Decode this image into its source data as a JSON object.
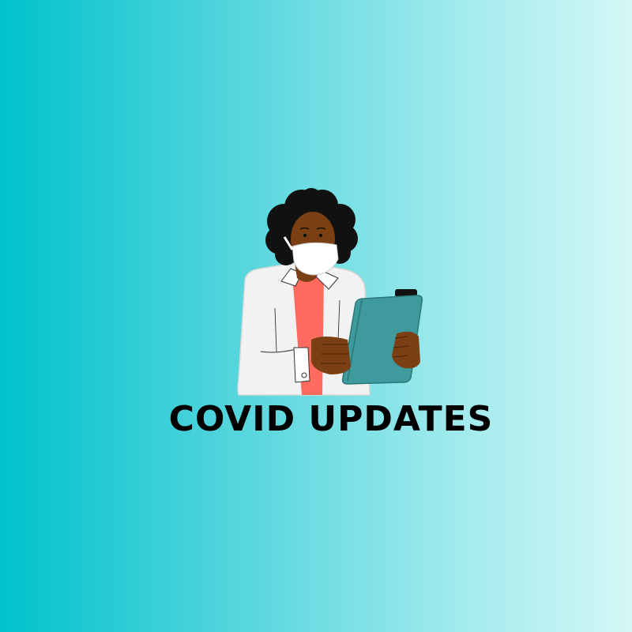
{
  "poster": {
    "title": "COVID UPDATES"
  },
  "illustration": {
    "subject": "healthcare-worker-with-clipboard-icon"
  },
  "colors": {
    "gradient_start": "#00c2cc",
    "gradient_end": "#d4f7f6",
    "coat": "#f2f2f2",
    "shirt": "#ff6b5e",
    "skin": "#7a3f12",
    "hair": "#111111",
    "mask": "#ffffff",
    "clipboard": "#3e9a9c",
    "title_text": "#000000"
  }
}
